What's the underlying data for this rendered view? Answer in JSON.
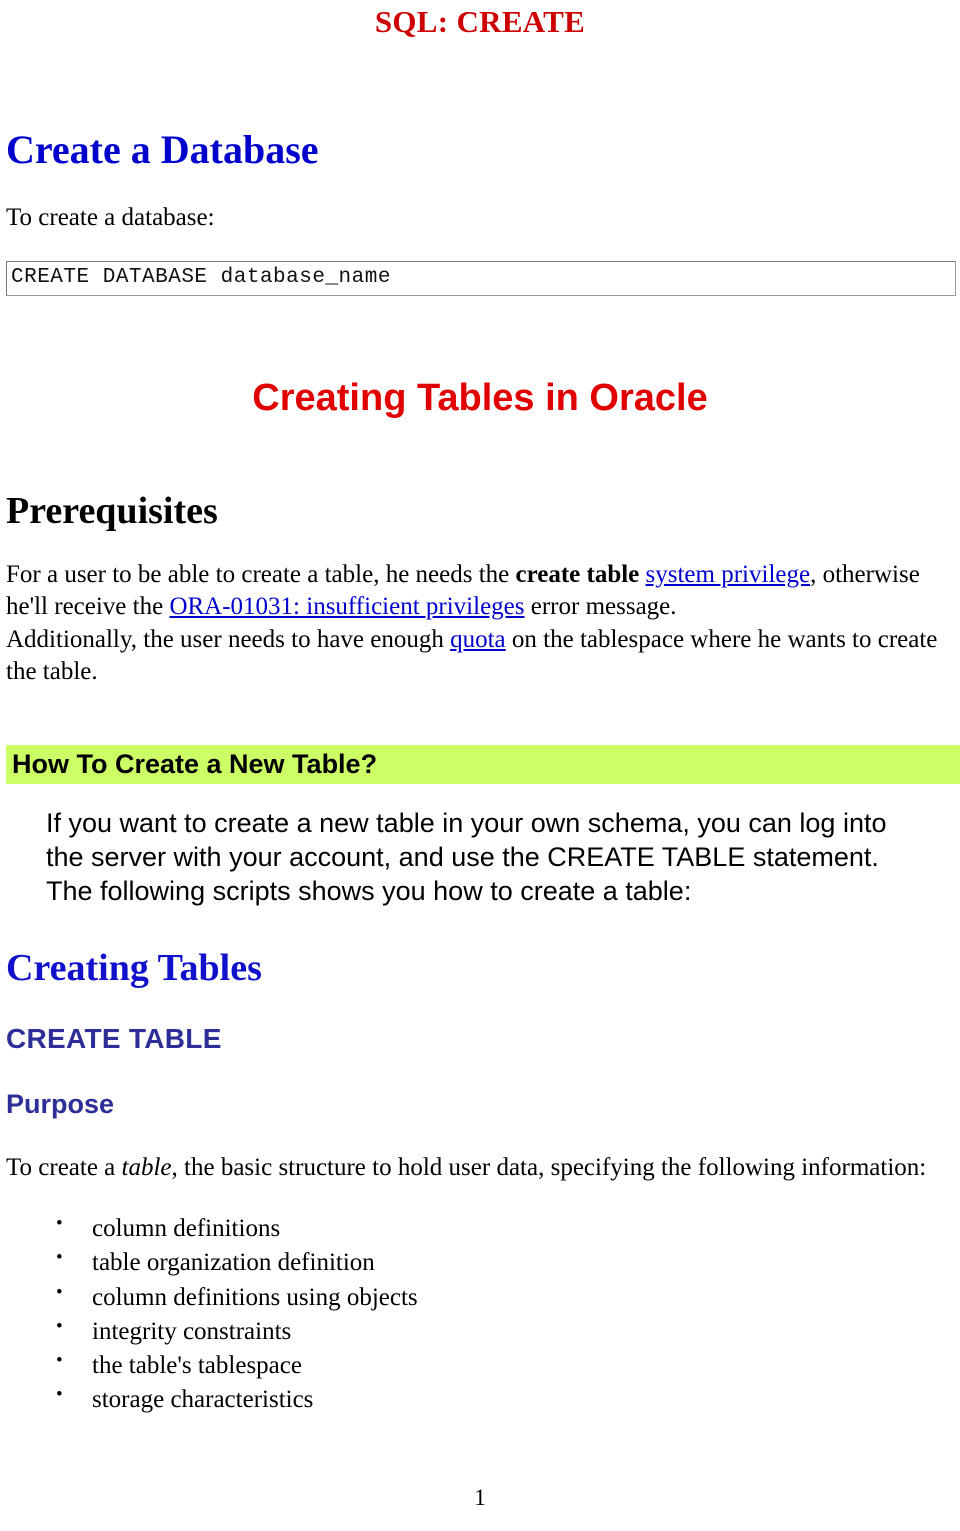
{
  "document": {
    "running_head": "SQL: CREATE",
    "page_number": "1"
  },
  "sections": {
    "create_database": {
      "heading": "Create a Database",
      "intro": "To create a database:",
      "code": "CREATE DATABASE database_name"
    },
    "creating_tables_oracle": {
      "heading": "Creating Tables in Oracle"
    },
    "prerequisites": {
      "heading": "Prerequisites",
      "text_part_1": "For a user to be able to create a table, he needs the ",
      "bold_1": "create table",
      "space_1": " ",
      "link_1": "system privilege",
      "text_part_2": ", otherwise he'll receive the ",
      "link_2": "ORA-01031: insufficient privileges",
      "text_part_3": " error message.",
      "text_part_4": "Additionally, the user needs to have enough ",
      "link_3": "quota",
      "text_part_5": " on the tablespace where he wants to create the table."
    },
    "how_to_create": {
      "heading": "How To Create a New Table?",
      "highlight_color": "#CCFF66",
      "body": "If you want to create a new table in your own schema, you can log into the server with your account, and use the CREATE TABLE statement. The following scripts shows you how to create a table:"
    },
    "creating_tables": {
      "heading": "Creating Tables"
    },
    "create_table": {
      "heading": "CREATE TABLE",
      "purpose_heading": "Purpose",
      "purpose_text_1": "To create a ",
      "purpose_italic": "table",
      "purpose_text_2": ", the basic structure to hold user data, specifying the following information:",
      "items": [
        "column definitions",
        "table organization definition",
        "column definitions using objects",
        "integrity constraints",
        "the table's tablespace",
        "storage characteristics"
      ]
    }
  },
  "colors": {
    "running_head": "#CC0000",
    "blue_heading": "#0000CC",
    "red_heading": "#E00000",
    "indigo_heading": "#2E2E99",
    "link": "#0000CC",
    "highlight": "#CCFF66"
  }
}
